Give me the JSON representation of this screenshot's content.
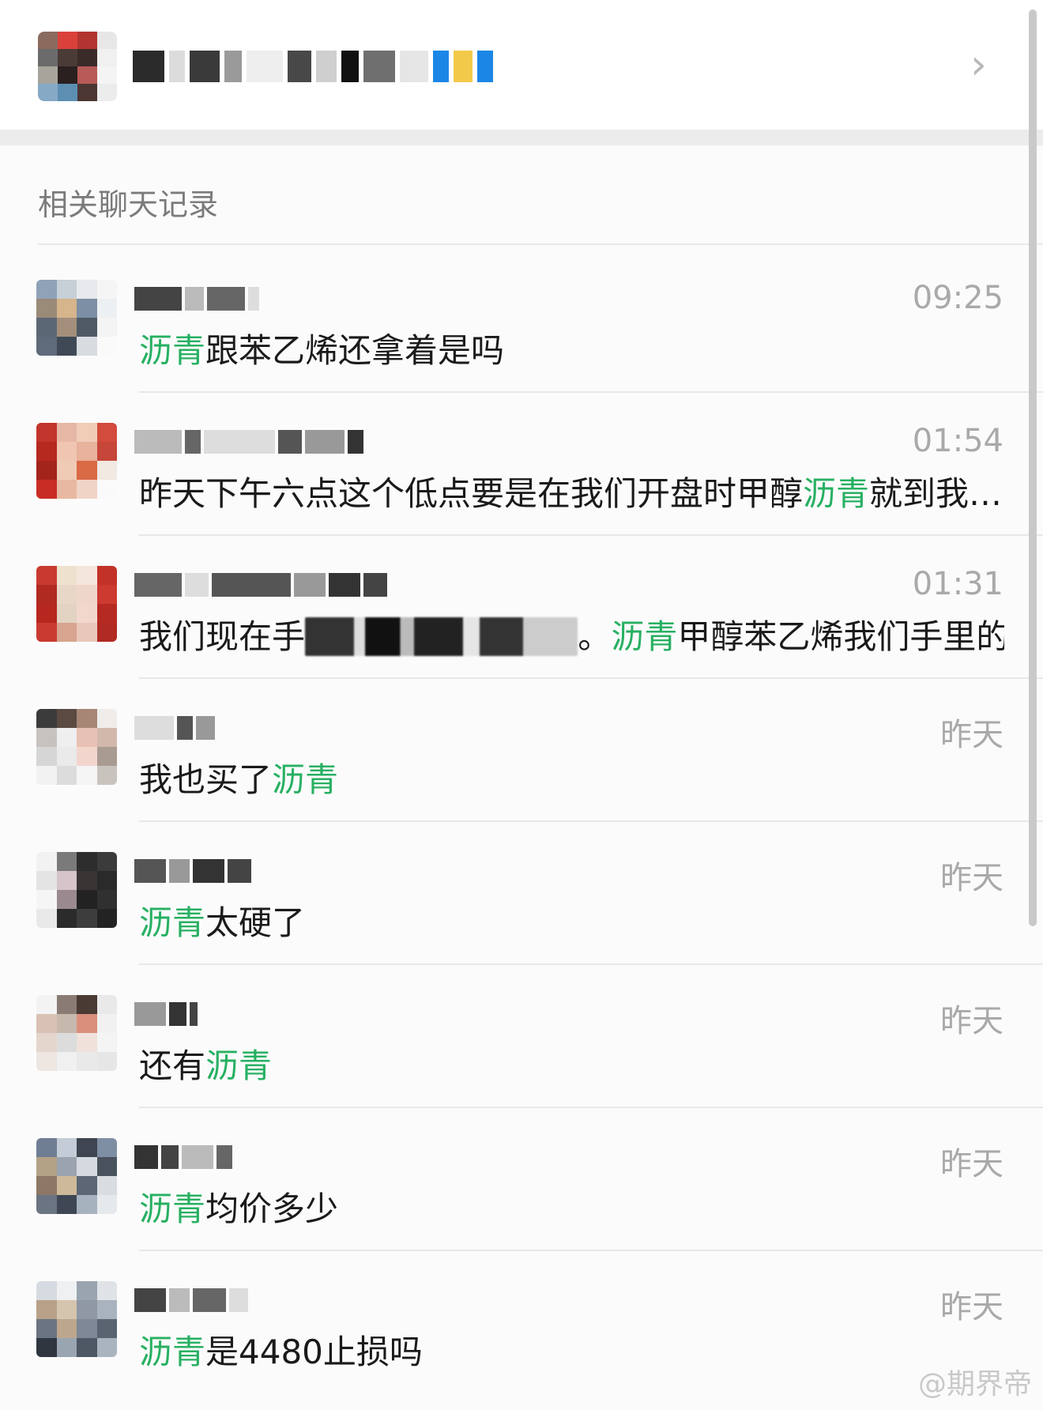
{
  "header": {
    "chevron": "›",
    "avatar_colors": [
      "#8a6b5e",
      "#d9413a",
      "#b23430",
      "#e7e7e7",
      "#6b6b6b",
      "#4a3b37",
      "#3a2b29",
      "#f0f0f0",
      "#a7a49c",
      "#2a2020",
      "#b85a57",
      "#f4f4f4",
      "#86a9c6",
      "#5c8fb2",
      "#4b3634",
      "#ececec"
    ],
    "name_blocks": [
      "#2b2b2b",
      "#dcdcdc",
      "#3a3a3a",
      "#9a9a9a",
      "#eeeeee",
      "#484848",
      "#cfcfcf",
      "#111111",
      "#6f6f6f",
      "#e6e6e6",
      "#1b86e6",
      "#f3c94a",
      "#1b86e6"
    ]
  },
  "section_title": "相关聊天记录",
  "chats": [
    {
      "time": "09:25",
      "parts": [
        {
          "t": "沥青",
          "hl": true
        },
        {
          "t": "跟苯乙烯还拿着是吗",
          "hl": false
        }
      ],
      "avatar": [
        "#8fa2b8",
        "#c7cfd7",
        "#e7e9ec",
        "#f5f5f5",
        "#9a8a78",
        "#d6b48c",
        "#7d8fa4",
        "#edf0f3",
        "#5c6775",
        "#a38f7b",
        "#4e5965",
        "#f4f4f4",
        "#5f6b7a",
        "#3f4956",
        "#d8dce1",
        "#fafafa"
      ]
    },
    {
      "time": "01:54",
      "parts": [
        {
          "t": "昨天下午六点这个低点要是在我们开盘时甲醇",
          "hl": false
        },
        {
          "t": "沥青",
          "hl": true
        },
        {
          "t": "就到我…",
          "hl": false
        }
      ],
      "avatar": [
        "#c2352c",
        "#e7b7a6",
        "#f1cdb8",
        "#d34b3c",
        "#b6291f",
        "#f0c6b2",
        "#e8b29c",
        "#c6463a",
        "#a3241b",
        "#efcbb6",
        "#d96a45",
        "#f1e9e2",
        "#c82d25",
        "#e8b8a2",
        "#f0d4c6",
        "#fafafa"
      ]
    },
    {
      "time": "01:31",
      "parts": [
        {
          "t": "我们现在手",
          "hl": false
        },
        {
          "t": "XXXXXXXXXXXX",
          "blur": true
        },
        {
          "t": "。",
          "hl": false
        },
        {
          "t": "沥青",
          "hl": true
        },
        {
          "t": "甲醇苯乙烯我们手里的品…",
          "hl": false
        }
      ],
      "avatar": [
        "#c83a30",
        "#eee2cf",
        "#f5e6dc",
        "#c23228",
        "#b02a21",
        "#e8d7c6",
        "#efd6cb",
        "#cc3a30",
        "#b5271f",
        "#e2d3c3",
        "#f2d7cd",
        "#b52a22",
        "#c93a31",
        "#d7a48f",
        "#e9c8bb",
        "#b12a23"
      ]
    },
    {
      "time": "昨天",
      "parts": [
        {
          "t": "我也买了",
          "hl": false
        },
        {
          "t": "沥青",
          "hl": true
        }
      ],
      "avatar": [
        "#3b3b3b",
        "#5b4a42",
        "#a78676",
        "#f0ece9",
        "#c8c2be",
        "#efefef",
        "#e7c1b3",
        "#d2b8ab",
        "#d6d6d6",
        "#eaeaea",
        "#f2d6cd",
        "#a89b92",
        "#f2f2f2",
        "#dcdcdc",
        "#f5f5f5",
        "#c9c3bd"
      ]
    },
    {
      "time": "昨天",
      "parts": [
        {
          "t": "沥青",
          "hl": true
        },
        {
          "t": "太硬了",
          "hl": false
        }
      ],
      "avatar": [
        "#f2f2f2",
        "#7a7a7a",
        "#2d2d2d",
        "#3b3b3b",
        "#e4e4e4",
        "#d6c4ca",
        "#3a3434",
        "#2a2a2a",
        "#f5f5f5",
        "#9a8a8f",
        "#222222",
        "#303030",
        "#e9e9e9",
        "#2b2b2b",
        "#3d3d3d",
        "#232323"
      ]
    },
    {
      "time": "昨天",
      "parts": [
        {
          "t": "还有",
          "hl": false
        },
        {
          "t": "沥青",
          "hl": true
        }
      ],
      "avatar": [
        "#f3f3f3",
        "#8a7c75",
        "#4a3a34",
        "#e9e9e9",
        "#d9c2b5",
        "#c7b8ae",
        "#d98f7c",
        "#f1f1f1",
        "#e4d6cd",
        "#dcdcdc",
        "#efe2da",
        "#f4f4f4",
        "#ede6e1",
        "#f0f0f0",
        "#e9e9e9",
        "#e6e6e6"
      ]
    },
    {
      "time": "昨天",
      "parts": [
        {
          "t": "沥青",
          "hl": true
        },
        {
          "t": "均价多少",
          "hl": false
        }
      ],
      "avatar": [
        "#6f7e93",
        "#c3ccd7",
        "#3f4651",
        "#7e8fa3",
        "#b4a287",
        "#9aa3ae",
        "#d5dae0",
        "#4a525d",
        "#8c7865",
        "#cfb99b",
        "#5c6674",
        "#d9dde2",
        "#6a7482",
        "#3e4753",
        "#a7b2bf",
        "#e6e9ec"
      ]
    },
    {
      "time": "昨天",
      "parts": [
        {
          "t": "沥青",
          "hl": true
        },
        {
          "t": "是4480止损吗",
          "hl": false
        }
      ],
      "avatar": [
        "#d6dbe1",
        "#eef0f2",
        "#9aa4b0",
        "#dfe3e7",
        "#b8a188",
        "#d6c5ae",
        "#8f98a4",
        "#a9b3be",
        "#6a7482",
        "#bca78e",
        "#7e8896",
        "#5a6370",
        "#2f3640",
        "#9aa5b2",
        "#4e5764",
        "#aab4bf"
      ]
    }
  ],
  "watermark": "@期界帝"
}
